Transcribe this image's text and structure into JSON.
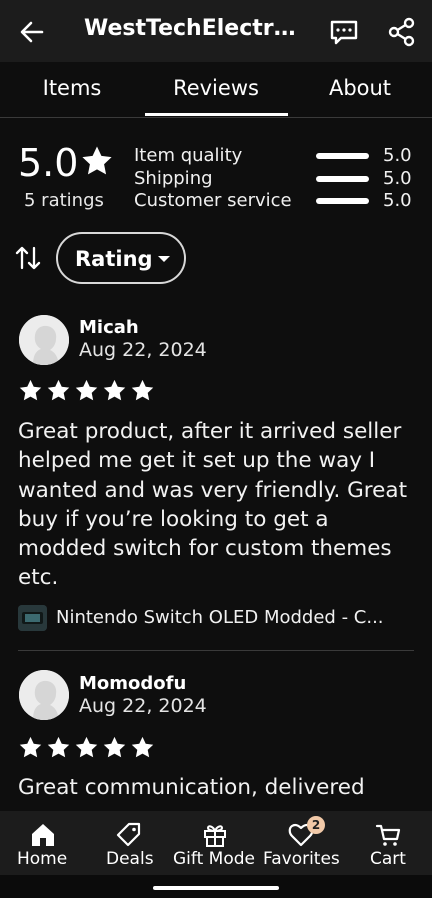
{
  "header": {
    "title": "WestTechElectro..."
  },
  "tabs": [
    {
      "label": "Items"
    },
    {
      "label": "Reviews"
    },
    {
      "label": "About"
    }
  ],
  "summary": {
    "rating": "5.0",
    "count_label": "5 ratings",
    "categories": [
      {
        "label": "Item quality",
        "value": "5.0"
      },
      {
        "label": "Shipping",
        "value": "5.0"
      },
      {
        "label": "Customer service",
        "value": "5.0"
      }
    ]
  },
  "sort": {
    "filter_label": "Rating"
  },
  "reviews": [
    {
      "name": "Micah",
      "date": "Aug 22, 2024",
      "stars": 5,
      "text": "Great product, after it arrived seller helped me get it set up the way I wanted and was very friendly. Great buy if you’re looking to get a modded switch for custom themes etc.",
      "item": "Nintendo Switch OLED Modded - C..."
    },
    {
      "name": "Momodofu",
      "date": "Aug 22, 2024",
      "stars": 5,
      "text": "Great communication, delivered"
    }
  ],
  "nav": [
    {
      "label": "Home",
      "icon": "home-icon"
    },
    {
      "label": "Deals",
      "icon": "tag-icon"
    },
    {
      "label": "Gift Mode",
      "icon": "gift-icon"
    },
    {
      "label": "Favorites",
      "icon": "heart-icon"
    },
    {
      "label": "Cart",
      "icon": "cart-icon"
    }
  ],
  "favorites_badge": "2",
  "colors": {
    "background": "#0e0e0e",
    "bar": "#1c1c1c",
    "badge": "#f1c9a8"
  }
}
